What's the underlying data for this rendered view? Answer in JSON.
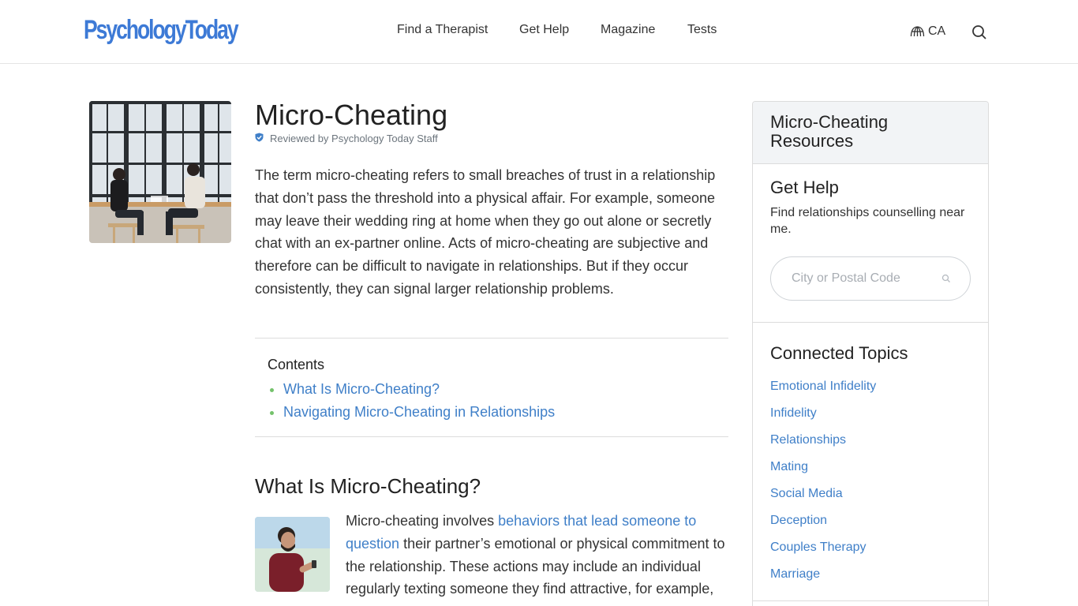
{
  "header": {
    "logo": "PsychologyToday",
    "nav": [
      "Find a Therapist",
      "Get Help",
      "Magazine",
      "Tests"
    ],
    "region": "CA",
    "region_icon": "globe-icon",
    "search_icon": "search-icon"
  },
  "article": {
    "title": "Micro-Cheating",
    "reviewed": "Reviewed by Psychology Today Staff",
    "intro": "The term micro-cheating refers to small breaches of trust in a relationship that don’t pass the threshold into a physical affair. For example, someone may leave their wedding ring at home when they go out alone or secretly chat with an ex-partner online. Acts of micro-cheating are subjective and therefore can be difficult to navigate in relationships. But if they occur consistently, they can signal larger relationship problems.",
    "contents": {
      "title": "Contents",
      "items": [
        "What Is Micro-Cheating?",
        "Navigating Micro-Cheating in Relationships"
      ]
    },
    "section1": {
      "heading": "What Is Micro-Cheating?",
      "text_before": "Micro-cheating involves ",
      "link": "behaviors that lead someone to question",
      "text_after": " their partner’s emotional or physical commitment to the relationship. These actions may include an individual regularly texting someone they find attractive, for example,"
    }
  },
  "sidebar": {
    "title": "Micro-Cheating Resources",
    "get_help_title": "Get Help",
    "get_help_desc": "Find relationships counselling near me.",
    "search_placeholder": "City or Postal Code",
    "topics_title": "Connected Topics",
    "topics": [
      "Emotional Infidelity",
      "Infidelity",
      "Relationships",
      "Mating",
      "Social Media",
      "Deception",
      "Couples Therapy",
      "Marriage"
    ]
  },
  "colors": {
    "brand": "#3d7ad6",
    "link": "#3f7fc8",
    "bullet": "#74c26b",
    "sidebar_header_bg": "#f2f4f6"
  }
}
